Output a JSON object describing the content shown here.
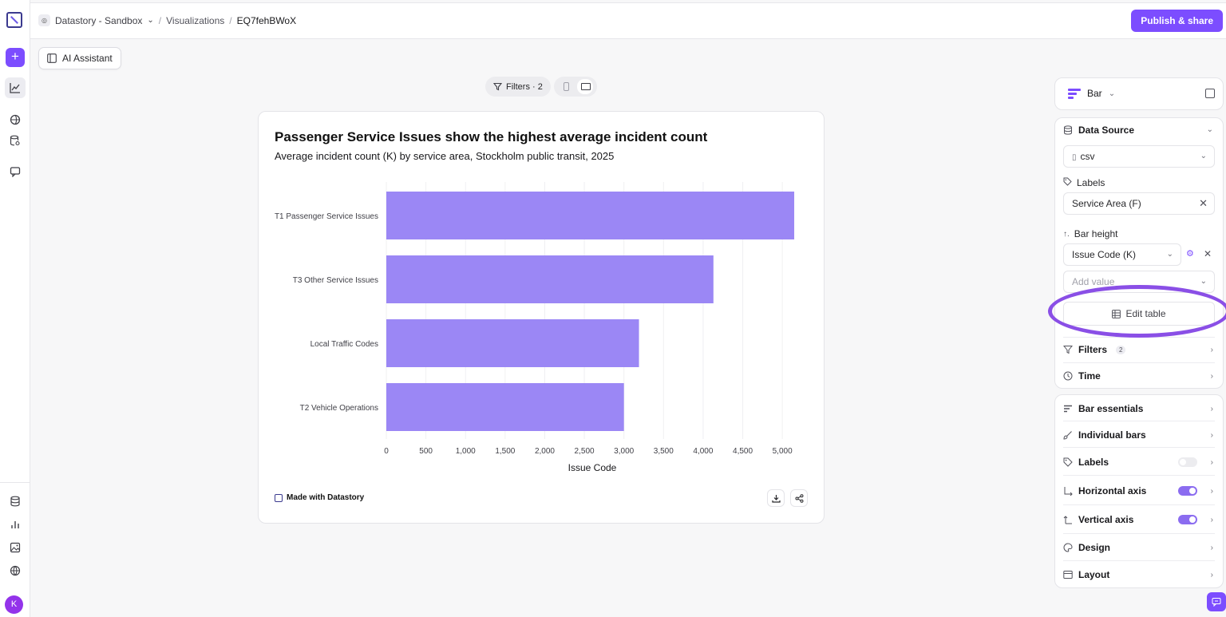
{
  "header": {
    "workspace": "Datastory - Sandbox",
    "section": "Visualizations",
    "current": "EQ7fehBWoX",
    "publish_label": "Publish & share"
  },
  "toolbar": {
    "ai_assistant_label": "AI Assistant",
    "filters_label": "Filters · 2"
  },
  "user": {
    "initial": "K"
  },
  "chart": {
    "title": "Passenger Service Issues show the highest average incident count",
    "subtitle": "Average incident count (K) by service area, Stockholm public transit, 2025",
    "made_with": "Made with Datastory"
  },
  "chart_data": {
    "type": "bar",
    "orientation": "horizontal",
    "categories": [
      "T1 Passenger Service Issues",
      "T3 Other Service Issues",
      "Local Traffic Codes",
      "T2 Vehicle Operations"
    ],
    "values": [
      5150,
      4130,
      3190,
      3000
    ],
    "xlabel": "Issue Code",
    "ylabel": "",
    "xlim": [
      0,
      5200
    ],
    "ticks": [
      0,
      500,
      1000,
      1500,
      2000,
      2500,
      3000,
      3500,
      4000,
      4500,
      5000
    ],
    "tick_labels": [
      "0",
      "500",
      "1,000",
      "1,500",
      "2,000",
      "2,500",
      "3,000",
      "3,500",
      "4,000",
      "4,500",
      "5,000"
    ],
    "bar_color": "#9b87f5",
    "grid": true
  },
  "panel": {
    "chart_type": "Bar",
    "data_source": {
      "title": "Data Source",
      "source": "csv",
      "labels_title": "Labels",
      "labels_value": "Service Area (F)",
      "bar_height_title": "Bar height",
      "bar_height_value": "Issue Code (K)",
      "add_value_placeholder": "Add value",
      "edit_table": "Edit table",
      "filters": "Filters",
      "filters_count": "2",
      "time": "Time"
    },
    "style": {
      "bar_essentials": "Bar essentials",
      "individual_bars": "Individual bars",
      "labels": "Labels",
      "horizontal_axis": "Horizontal axis",
      "vertical_axis": "Vertical axis",
      "design": "Design",
      "layout": "Layout"
    }
  },
  "colors": {
    "accent": "#7c4dff",
    "bar": "#9b87f5",
    "highlight": "#8a4fe6"
  }
}
